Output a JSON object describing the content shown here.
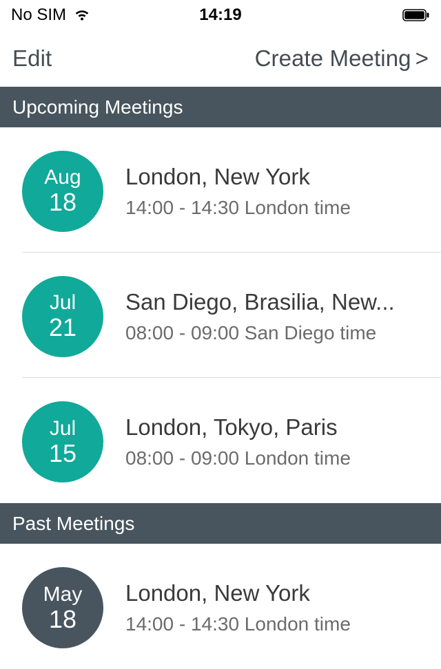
{
  "statusBar": {
    "carrier": "No SIM",
    "time": "14:19"
  },
  "nav": {
    "edit": "Edit",
    "create": "Create Meeting",
    "chevron": ">"
  },
  "sections": {
    "upcoming": {
      "title": "Upcoming Meetings"
    },
    "past": {
      "title": "Past Meetings"
    }
  },
  "upcoming": [
    {
      "month": "Aug",
      "day": "18",
      "title": "London, New York",
      "time": "14:00 - 14:30 London time"
    },
    {
      "month": "Jul",
      "day": "21",
      "title": "San Diego, Brasilia, New...",
      "time": "08:00 - 09:00 San Diego time"
    },
    {
      "month": "Jul",
      "day": "15",
      "title": "London, Tokyo, Paris",
      "time": "08:00 - 09:00 London time"
    }
  ],
  "past": [
    {
      "month": "May",
      "day": "18",
      "title": "London, New York",
      "time": "14:00 - 14:30 London time"
    }
  ],
  "colors": {
    "upcomingCircle": "#11a999",
    "pastCircle": "#48555e",
    "sectionHeader": "#48555e"
  }
}
